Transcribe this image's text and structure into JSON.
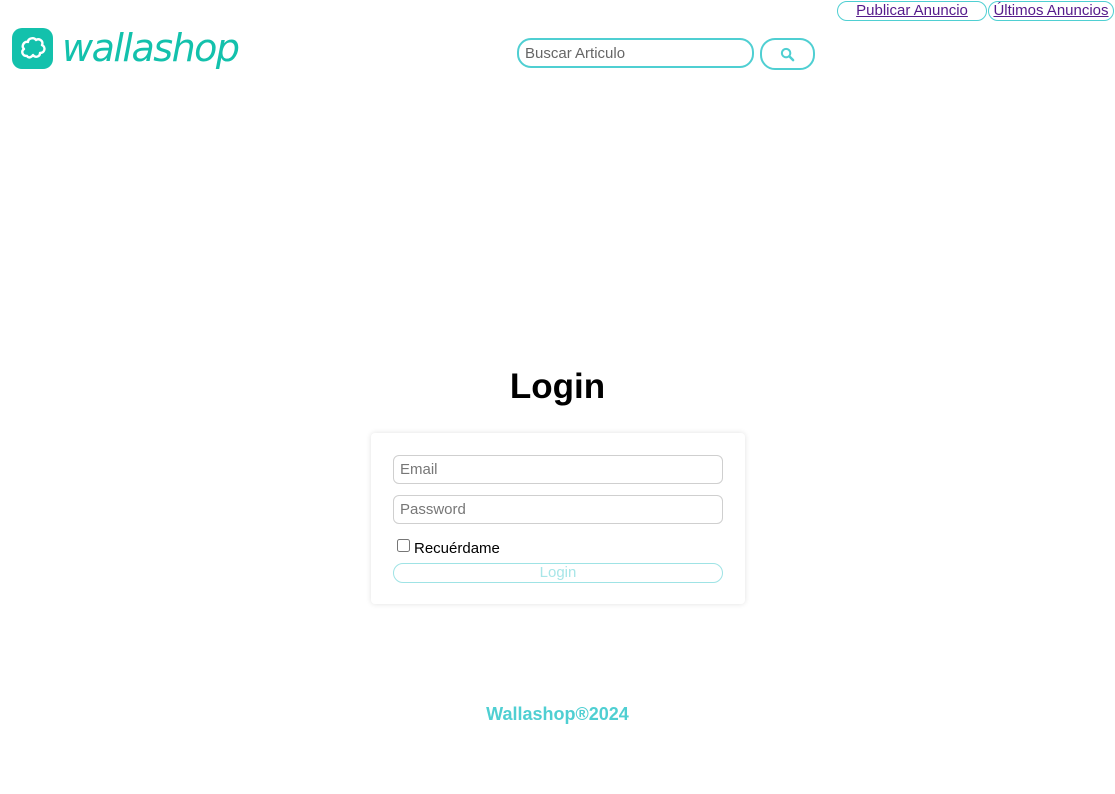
{
  "nav": {
    "publish_label": "Publicar Anuncio",
    "latest_label": "Últimos Anuncios"
  },
  "logo": {
    "text": "wallashop",
    "icon": "cloud-icon"
  },
  "search": {
    "placeholder": "Buscar Articulo",
    "value": "",
    "icon": "search-icon"
  },
  "login": {
    "title": "Login",
    "email_placeholder": "Email",
    "password_placeholder": "Password",
    "remember_label": "Recuérdame",
    "remember_checked": false,
    "button_label": "Login"
  },
  "footer": {
    "text": "Wallashop®2024"
  },
  "colors": {
    "brand": "#13c1ac",
    "accent": "#4fcfd2",
    "link": "#551a8b"
  }
}
